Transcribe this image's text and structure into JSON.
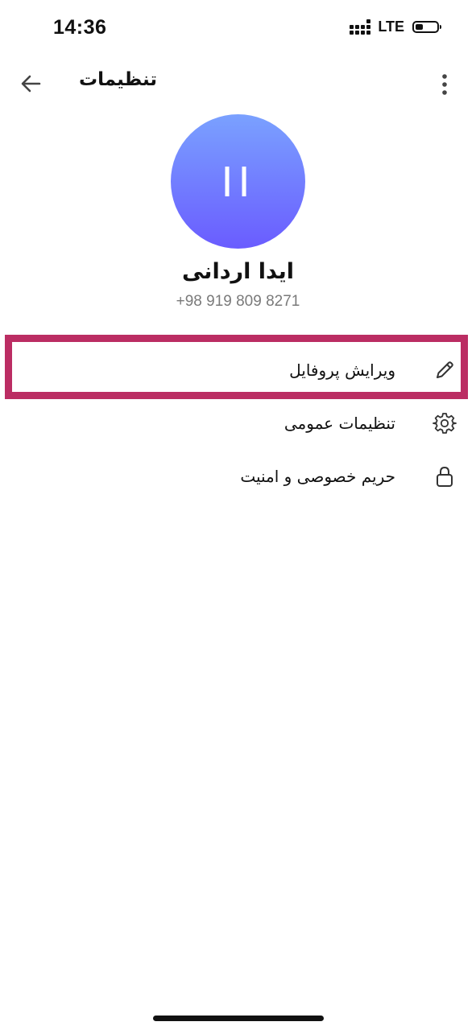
{
  "status_bar": {
    "time": "14:36",
    "network": "LTE",
    "battery_level": 0.35
  },
  "topbar": {
    "title": "تنظیمات",
    "back_icon": "arrow-left-icon",
    "more_icon": "more-vertical-icon"
  },
  "profile": {
    "initials": "II",
    "name": "ایدا اردانی",
    "phone": "+98 919 809 8271",
    "avatar_gradient": [
      "#7aa1ff",
      "#6a5cff"
    ]
  },
  "menu": {
    "items": [
      {
        "label": "ویرایش پروفایل",
        "icon": "pencil-icon"
      },
      {
        "label": "تنظیمات عمومی",
        "icon": "gear-icon"
      },
      {
        "label": "حریم خصوصی و امنیت",
        "icon": "lock-icon"
      }
    ]
  },
  "colors": {
    "highlight": "#bb2d63",
    "icon": "#333333",
    "secondary_text": "#7a7a7a"
  }
}
